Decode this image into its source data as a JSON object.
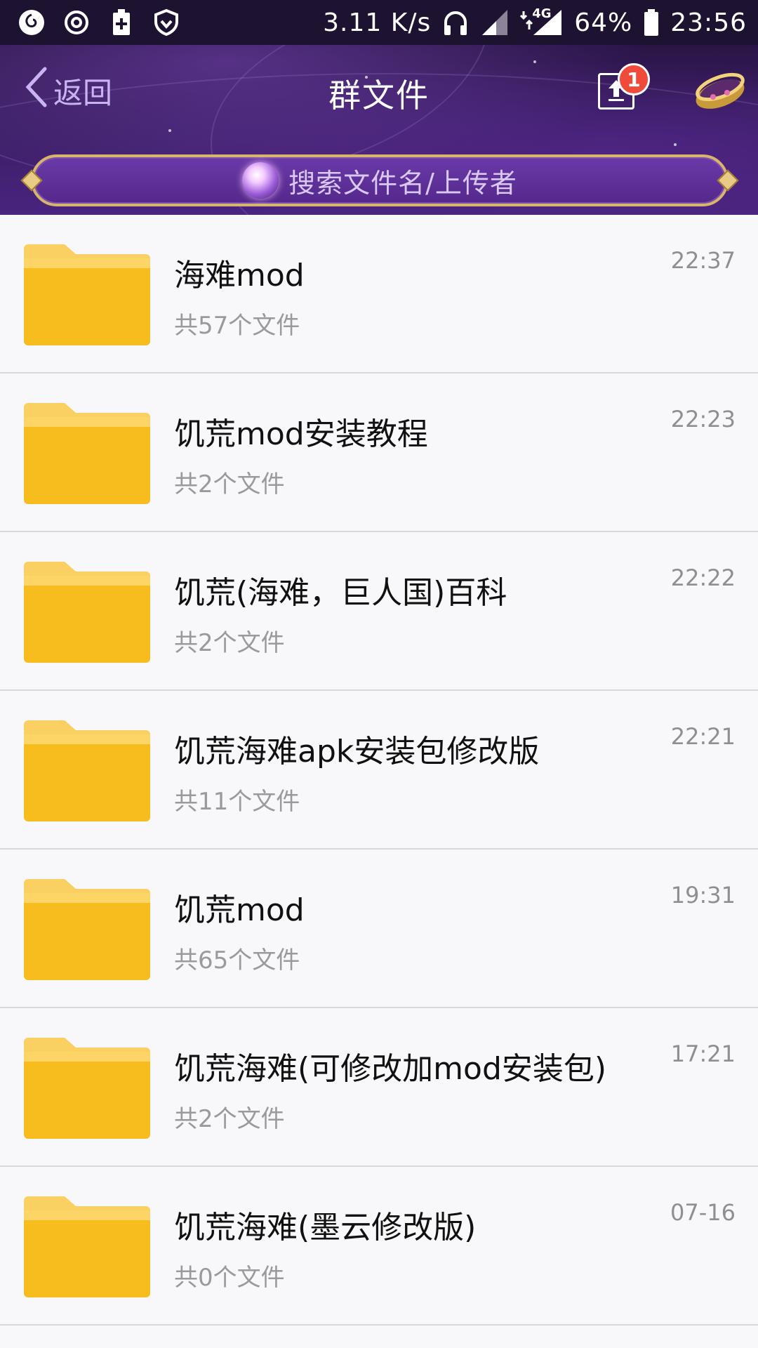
{
  "status_bar": {
    "net_speed": "3.11 K/s",
    "network_type": "4G",
    "battery": "64%",
    "time": "23:56",
    "icons": [
      "netease-music-icon",
      "sync-icon",
      "battery-saver-icon",
      "shield-icon",
      "headphones-icon",
      "signal-icon",
      "signal-4g-icon",
      "battery-icon"
    ]
  },
  "header": {
    "back_label": "返回",
    "title": "群文件",
    "upload_badge": "1"
  },
  "search": {
    "placeholder": "搜索文件名/上传者"
  },
  "files": [
    {
      "name": "海难mod",
      "count": "共57个文件",
      "time": "22:37"
    },
    {
      "name": "饥荒mod安装教程",
      "count": "共2个文件",
      "time": "22:23"
    },
    {
      "name": "饥荒(海难，巨人国)百科",
      "count": "共2个文件",
      "time": "22:22"
    },
    {
      "name": "饥荒海难apk安装包修改版",
      "count": "共11个文件",
      "time": "22:21"
    },
    {
      "name": "饥荒mod",
      "count": "共65个文件",
      "time": "19:31"
    },
    {
      "name": "饥荒海难(可修改加mod安装包)",
      "count": "共2个文件",
      "time": "17:21"
    },
    {
      "name": "饥荒海难(墨云修改版)",
      "count": "共0个文件",
      "time": "07-16"
    }
  ],
  "colors": {
    "header_bg": "#3c1f66",
    "folder": "#f7bd1f",
    "badge": "#f04a3a",
    "back_text": "#c9b3f3"
  }
}
